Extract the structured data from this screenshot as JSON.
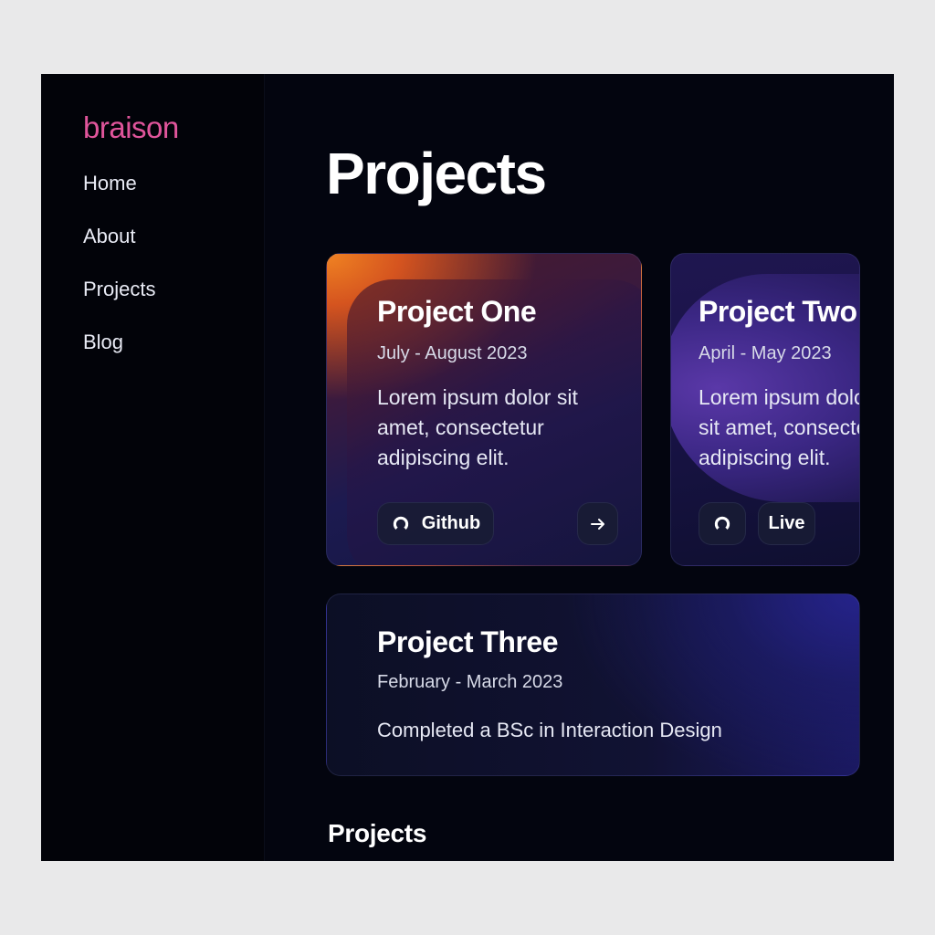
{
  "brand": {
    "logo": "braison",
    "accent_color": "#e0559b"
  },
  "nav": {
    "items": [
      {
        "label": "Home"
      },
      {
        "label": "About"
      },
      {
        "label": "Projects"
      },
      {
        "label": "Blog"
      }
    ]
  },
  "main": {
    "title": "Projects",
    "projects": [
      {
        "title": "Project One",
        "date": "July - August 2023",
        "description": "Lorem ipsum dolor sit amet, consectetur adipiscing elit.",
        "actions": {
          "github_label": "Github",
          "github_icon": "github-icon",
          "open_icon": "arrow-right-icon"
        }
      },
      {
        "title": "Project Two",
        "date": "April - May 2023",
        "description_lines": [
          "Lorem ipsum dolor",
          "sit amet, consectetur",
          "adipiscing elit."
        ],
        "actions": {
          "github_icon": "github-icon",
          "live_label": "Live"
        }
      },
      {
        "title": "Project Three",
        "date": "February - March 2023",
        "description": "Completed a BSc in Interaction Design"
      }
    ],
    "section_title": "Projects"
  }
}
